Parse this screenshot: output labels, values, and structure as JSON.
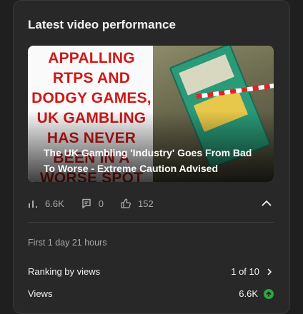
{
  "card": {
    "title": "Latest video performance"
  },
  "video": {
    "thumbnail_text": "APPALLING RTPS AND DODGY GAMES, UK GAMBLING HAS NEVER BEEN IN A WORSE SPOT",
    "title": "The UK Gambling 'Industry' Goes From Bad To Worse - Extreme Caution Advised"
  },
  "stats": {
    "views": "6.6K",
    "comments": "0",
    "likes": "152"
  },
  "period": "First 1 day 21 hours",
  "ranking": {
    "label": "Ranking by views",
    "value": "1 of 10"
  },
  "views_row": {
    "label": "Views",
    "value": "6.6K",
    "trend": "up",
    "trend_color": "#2ba640"
  }
}
